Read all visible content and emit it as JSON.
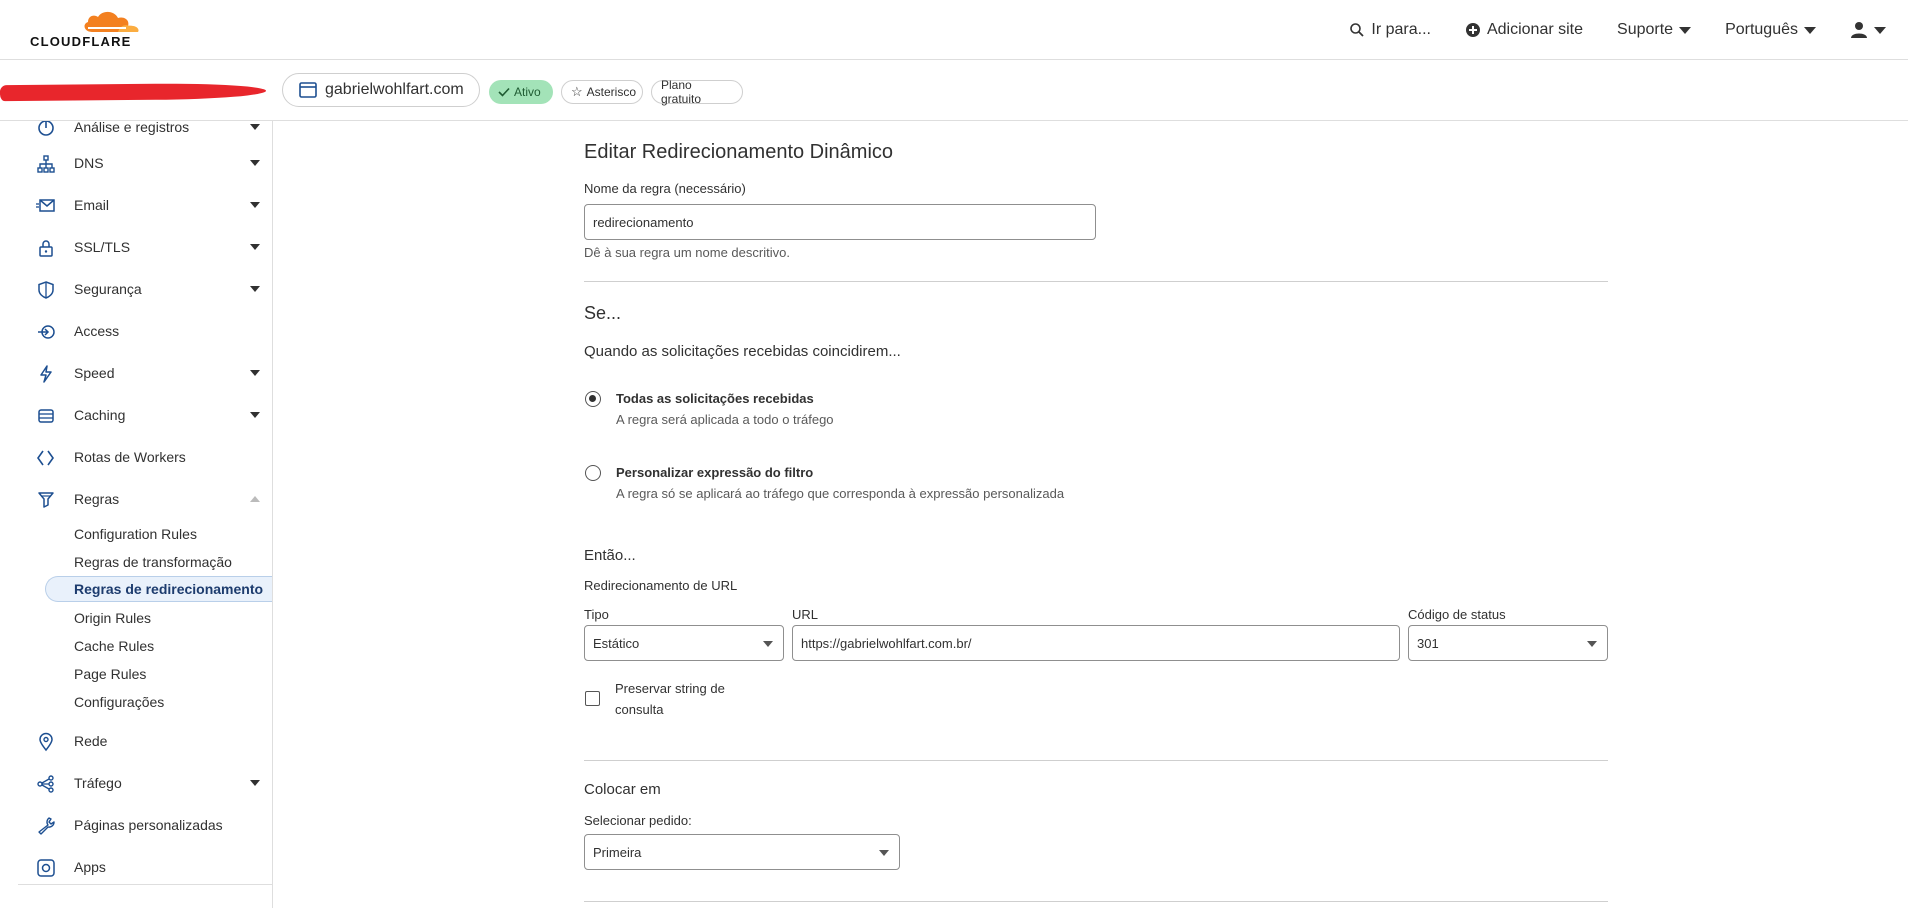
{
  "topbar": {
    "logo_text": "CLOUDFLARE",
    "goto_label": "Ir para...",
    "add_site_label": "Adicionar site",
    "support_label": "Suporte",
    "language_label": "Português"
  },
  "zone": {
    "domain": "gabrielwohlfart.com",
    "status": "Ativo",
    "star_label": "Asterisco",
    "plan": "Plano gratuito"
  },
  "sidebar": {
    "items": [
      {
        "label": "Análise e registros",
        "icon": "chart-icon"
      },
      {
        "label": "DNS",
        "icon": "network-icon"
      },
      {
        "label": "Email",
        "icon": "email-icon"
      },
      {
        "label": "SSL/TLS",
        "icon": "lock-icon"
      },
      {
        "label": "Segurança",
        "icon": "shield-icon"
      },
      {
        "label": "Access",
        "icon": "access-icon"
      },
      {
        "label": "Speed",
        "icon": "lightning-icon"
      },
      {
        "label": "Caching",
        "icon": "storage-icon"
      },
      {
        "label": "Rotas de Workers",
        "icon": "workers-icon"
      },
      {
        "label": "Regras",
        "icon": "rules-icon"
      },
      {
        "label": "Rede",
        "icon": "location-pin-icon"
      },
      {
        "label": "Tráfego",
        "icon": "traffic-icon"
      },
      {
        "label": "Páginas personalizadas",
        "icon": "wrench-icon"
      },
      {
        "label": "Apps",
        "icon": "apps-icon"
      }
    ],
    "rules_sub": [
      "Configuration Rules",
      "Regras de transformação",
      "Regras de redirecionamento",
      "Origin Rules",
      "Cache Rules",
      "Page Rules",
      "Configurações"
    ]
  },
  "form": {
    "title": "Editar Redirecionamento Dinâmico",
    "rule_name_label": "Nome da regra (necessário)",
    "rule_name_value": "redirecionamento",
    "rule_name_help": "Dê à sua regra um nome descritivo.",
    "if_title": "Se...",
    "match_title": "Quando as solicitações recebidas coincidirem...",
    "option_all_title": "Todas as solicitações recebidas",
    "option_all_desc": "A regra será aplicada a todo o tráfego",
    "option_custom_title": "Personalizar expressão do filtro",
    "option_custom_desc": "A regra só se aplicará ao tráfego que corresponda à expressão personalizada",
    "then_title": "Então...",
    "redirect_label": "Redirecionamento de URL",
    "type_label": "Tipo",
    "type_value": "Estático",
    "url_label": "URL",
    "url_value": "https://gabrielwohlfart.com.br/",
    "status_label": "Código de status",
    "status_value": "301",
    "preserve_label_1": "Preservar string de",
    "preserve_label_2": "consulta",
    "place_title": "Colocar em",
    "order_label": "Selecionar pedido:",
    "order_value": "Primeira"
  },
  "colors": {
    "brand_orange": "#f38020",
    "accent_blue": "#1d4f91",
    "active_badge": "#a3e3b8"
  }
}
